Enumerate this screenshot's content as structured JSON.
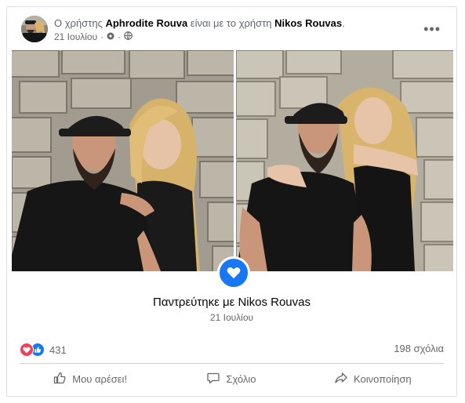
{
  "post": {
    "author_prefix": "Ο χρήστης ",
    "author_name": "Aphrodite Rouva",
    "with_text": " είναι με το χρήστη ",
    "tagged_name": "Nikos Rouvas",
    "tagged_suffix": ".",
    "date": "21 Ιουλίου",
    "separator": "·",
    "more_icon": "more-dots-icon"
  },
  "life_event": {
    "icon": "heart-icon",
    "title": "Παντρεύτηκε με Nikos Rouvas",
    "date": "21 Ιουλίου"
  },
  "stats": {
    "reactions_count": "431",
    "comments_count": "198 σχόλια"
  },
  "actions": {
    "like_label": "Μου αρέσει!",
    "comment_label": "Σχόλιο",
    "share_label": "Κοινοποίηση"
  },
  "colors": {
    "accent": "#1877f2",
    "love": "#f33e58",
    "muted": "#65676b"
  }
}
